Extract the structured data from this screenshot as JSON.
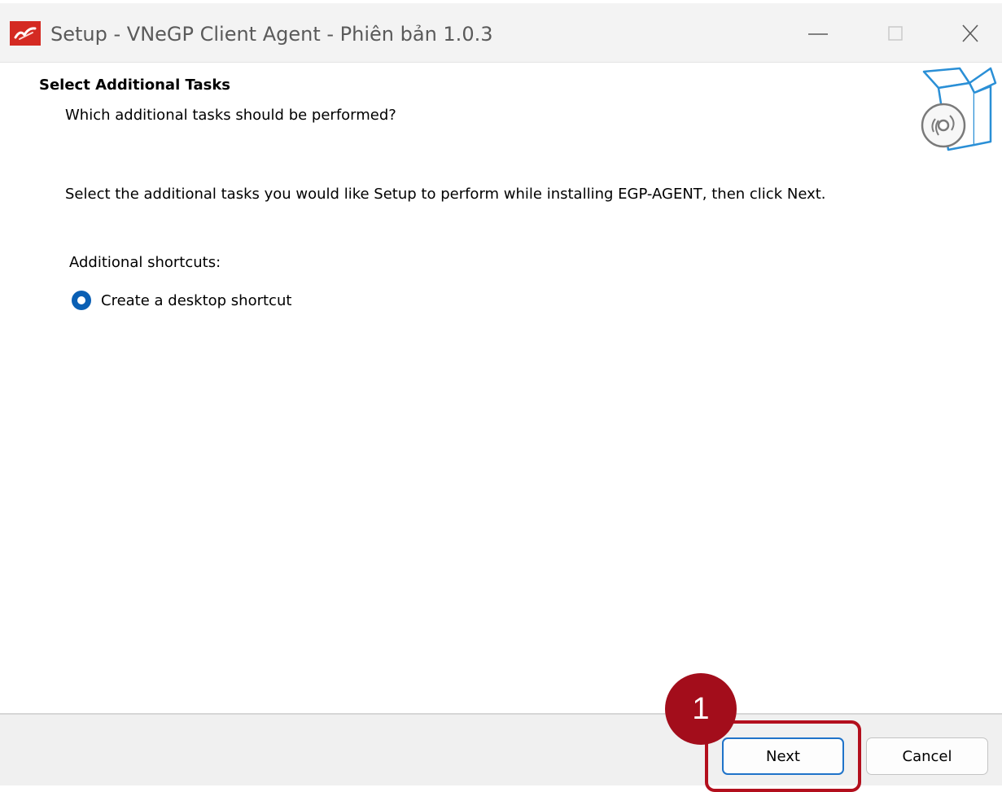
{
  "window": {
    "title": "Setup - VNeGP Client Agent - Phiên bản 1.0.3",
    "controls": [
      "minimize-icon",
      "maximize-icon",
      "close-icon"
    ]
  },
  "page": {
    "heading": "Select Additional Tasks",
    "subheading": "Which additional tasks should be performed?",
    "instruction": "Select the additional tasks you would like Setup to perform while installing EGP-AGENT, then click Next.",
    "group_label": "Additional shortcuts:",
    "options": [
      {
        "label": "Create a desktop shortcut",
        "selected": true
      }
    ]
  },
  "footer": {
    "next_label": "Next",
    "cancel_label": "Cancel"
  },
  "annotation": {
    "step_number": "1"
  },
  "colors": {
    "accent": "#0a5fb4",
    "annotation": "#a30d1b",
    "titlebar": "#f3f3f3",
    "footer": "#f0f0f0"
  }
}
